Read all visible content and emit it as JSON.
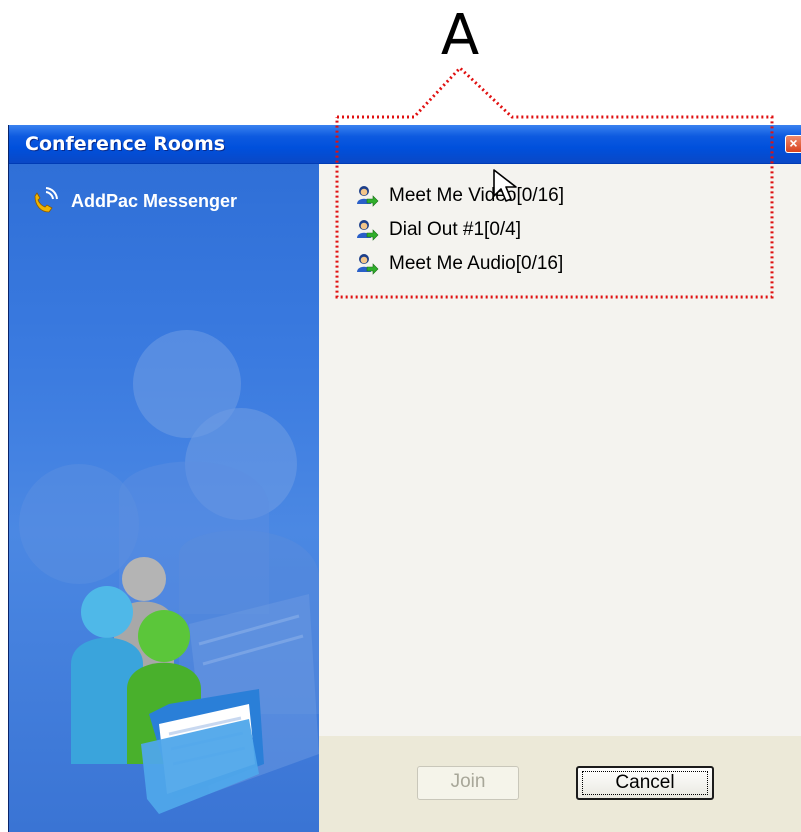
{
  "annotation": {
    "label": "A"
  },
  "window": {
    "title": "Conference Rooms",
    "close_symbol": "×"
  },
  "sidebar": {
    "brand": "AddPac Messenger",
    "brand_icon": "phone-handset-icon"
  },
  "rooms": [
    {
      "label": "Meet Me Video[0/16]",
      "icon": "join-room-icon"
    },
    {
      "label": "Dial Out #1[0/4]",
      "icon": "join-room-icon"
    },
    {
      "label": "Meet Me Audio[0/16]",
      "icon": "join-room-icon"
    }
  ],
  "buttons": {
    "join": "Join",
    "cancel": "Cancel"
  },
  "colors": {
    "annotation_red": "#e01010",
    "titlebar_blue": "#0050dc",
    "sidebar_blue": "#3b7be0"
  }
}
